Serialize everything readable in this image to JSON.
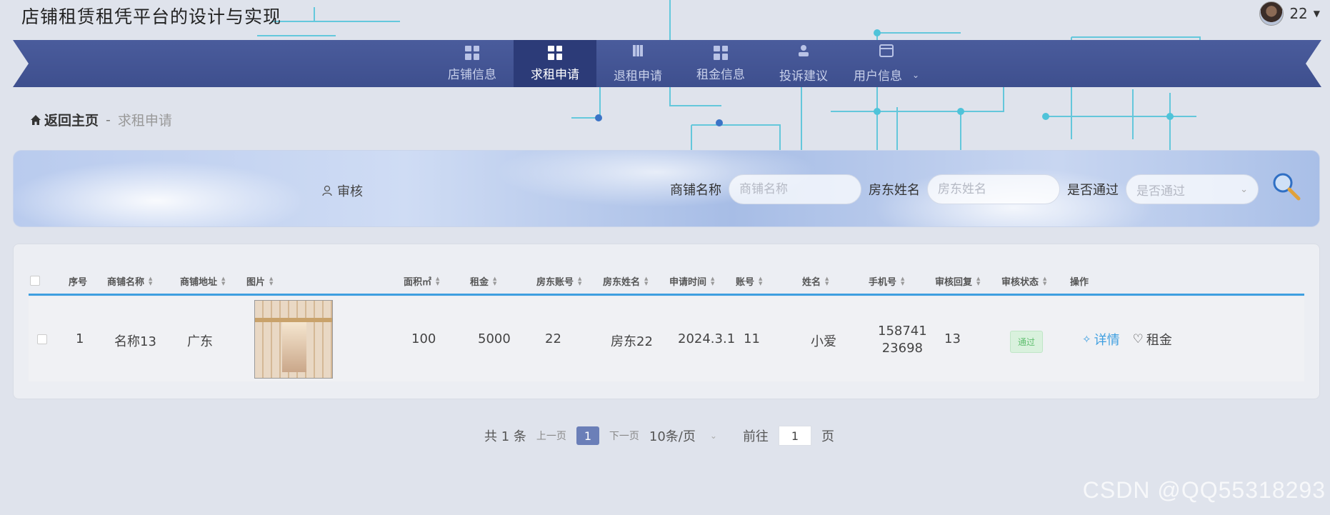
{
  "app": {
    "title": "店铺租赁租凭平台的设计与实现",
    "user_name": "22"
  },
  "nav": {
    "items": [
      {
        "label": "店铺信息",
        "active": false
      },
      {
        "label": "求租申请",
        "active": true
      },
      {
        "label": "退租申请",
        "active": false
      },
      {
        "label": "租金信息",
        "active": false
      },
      {
        "label": "投诉建议",
        "active": false
      },
      {
        "label": "用户信息",
        "active": false
      }
    ]
  },
  "breadcrumb": {
    "home": "返回主页",
    "separator": "-",
    "current": "求租申请"
  },
  "search": {
    "audit_label": "审核",
    "shop_name_label": "商铺名称",
    "shop_name_placeholder": "商铺名称",
    "landlord_label": "房东姓名",
    "landlord_placeholder": "房东姓名",
    "passed_label": "是否通过",
    "passed_placeholder": "是否通过"
  },
  "table": {
    "headers": {
      "index": "序号",
      "shop_name": "商铺名称",
      "shop_address": "商铺地址",
      "image": "图片",
      "area": "面积㎡",
      "rent": "租金",
      "landlord_account": "房东账号",
      "landlord_name": "房东姓名",
      "apply_time": "申请时间",
      "account": "账号",
      "name": "姓名",
      "phone": "手机号",
      "reply": "审核回复",
      "status": "审核状态",
      "ops": "操作"
    },
    "rows": [
      {
        "index": "1",
        "shop_name": "名称13",
        "shop_address": "广东",
        "area": "100",
        "rent": "5000",
        "landlord_account": "22",
        "landlord_name": "房东22",
        "apply_time": "2024.3.1",
        "account": "11",
        "name": "小爱",
        "phone_line1": "158741",
        "phone_line2": "23698",
        "reply": "13",
        "status": "通过",
        "detail_label": "详情",
        "rent_label": "租金"
      }
    ]
  },
  "pager": {
    "total": "共 1 条",
    "prev": "上一页",
    "page": "1",
    "next": "下一页",
    "page_size": "10条/页",
    "goto_label": "前往",
    "goto_value": "1",
    "page_unit": "页"
  },
  "watermark": "CSDN @QQ55318293"
}
